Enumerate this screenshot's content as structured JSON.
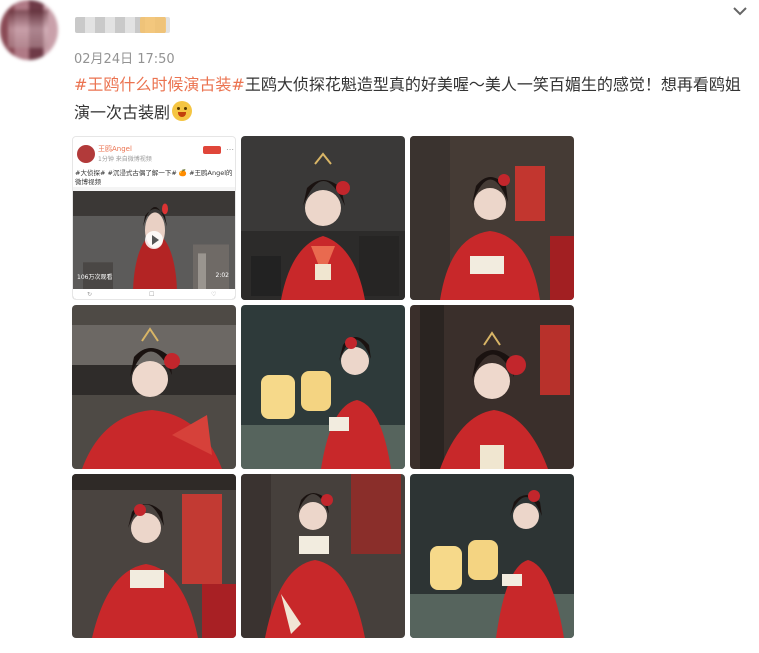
{
  "post": {
    "timestamp": "02月24日 17:50",
    "topic": "#王鸥什么时候演古装#",
    "body": "王鸥大侦探花魁造型真的好美喔～美人一笑百媚生的感觉！想再看鸥姐演一次古装剧"
  },
  "embedded_card": {
    "name": "王鸥Angel",
    "meta": "1分钟 来自微博视频",
    "text": "#大侦探# #沉浸式古偶了解一下# 🍊 #王鸥Angel的微博视频",
    "views": "106万次观看",
    "duration": "2:02",
    "footer_left": "↻",
    "footer_mid": "☐",
    "footer_right": "♡"
  },
  "icons": {
    "menu": "chevron-down-icon",
    "emoji": "scream-emoji-icon",
    "play": "play-icon"
  },
  "colors": {
    "topic": "#eb7350",
    "costume_red": "#c8282a"
  },
  "photos": [
    "embedded-video-card",
    "red-costume-portrait-seated",
    "red-costume-writing",
    "red-costume-smile-closeup",
    "red-costume-reading-lanterns",
    "red-costume-laughing",
    "red-costume-reading-book",
    "red-costume-reading-standing",
    "red-costume-lanterns-side"
  ]
}
